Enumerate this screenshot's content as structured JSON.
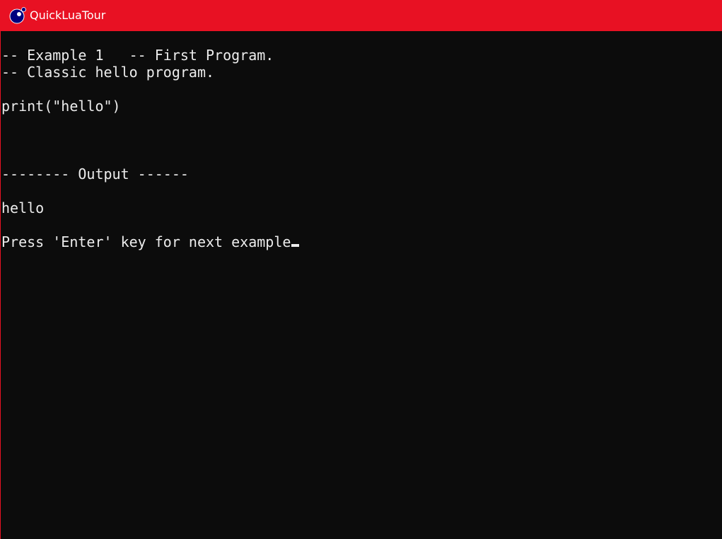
{
  "window": {
    "title": "QuickLuaTour",
    "icon": "lua-logo-icon",
    "titlebar_color": "#e81123",
    "background_color": "#0c0c0c",
    "text_color": "#ececec"
  },
  "console": {
    "lines": [
      "-- Example 1   -- First Program.",
      "-- Classic hello program.",
      "",
      "print(\"hello\")",
      "",
      "",
      "",
      "-------- Output ------",
      "",
      "hello",
      "",
      "Press 'Enter' key for next example"
    ]
  }
}
